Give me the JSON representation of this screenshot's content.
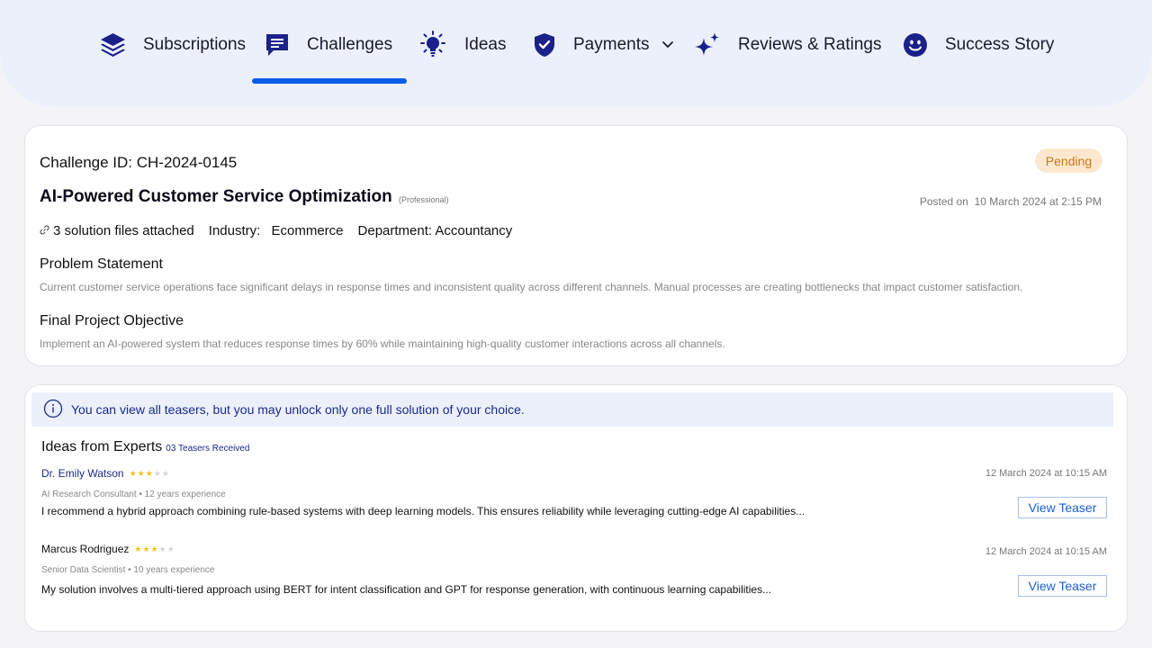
{
  "nav": {
    "items": [
      {
        "label": "Subscriptions",
        "icon": "layers-icon"
      },
      {
        "label": "Challenges",
        "icon": "chat-icon",
        "active": true
      },
      {
        "label": "Ideas",
        "icon": "lightbulb-icon"
      },
      {
        "label": "Payments",
        "icon": "shield-check-icon",
        "has_dropdown": true
      },
      {
        "label": "Reviews & Ratings",
        "icon": "sparkle-icon"
      },
      {
        "label": "Success Story",
        "icon": "smiley-icon"
      }
    ],
    "accent_color": "#0a5ce8",
    "icon_color": "#1a2189"
  },
  "challenge": {
    "id_label": "Challenge ID: CH-2024-0145",
    "status": "Pending",
    "title": "AI-Powered Customer Service Optimization",
    "level": "(Professional)",
    "posted_label": "Posted on",
    "posted_date": "10 March 2024 at 2:15 PM",
    "files": "3 solution files attached",
    "industry_label": "Industry:",
    "industry": "Ecommerce",
    "department": "Department: Accountancy",
    "problem_heading": "Problem Statement",
    "problem_text": "Current customer service operations face significant delays in response times and inconsistent quality across different channels. Manual processes are creating bottlenecks that impact customer satisfaction.",
    "objective_heading": "Final Project Objective",
    "objective_text": "Implement an AI-powered system that reduces response times by 60% while maintaining high-quality customer interactions across all channels."
  },
  "ideas": {
    "banner": "You can view all teasers, but you may unlock only one full solution of your choice.",
    "title": "Ideas from Experts",
    "teasers_count": "03 Teasers Received",
    "experts": [
      {
        "name": "Dr. Emily Watson",
        "rating": 3,
        "max_rating": 5,
        "time": "12 March 2024 at 10:15 AM",
        "role": "AI Research Consultant • 12 years experience",
        "text": "I recommend a hybrid approach combining rule-based systems with deep learning models. This ensures reliability while leveraging cutting-edge AI capabilities...",
        "button": "View Teaser",
        "name_color": "#1c2a8a"
      },
      {
        "name": "Marcus Rodriguez",
        "rating": 3,
        "max_rating": 5,
        "time": "12 March 2024 at 10:15 AM",
        "role": "Senior Data Scientist • 10 years experience",
        "text": "My solution involves a multi-tiered approach using BERT for intent classification and GPT for response generation, with continuous learning capabilities...",
        "button": "View Teaser",
        "name_color": "#111111"
      }
    ]
  }
}
